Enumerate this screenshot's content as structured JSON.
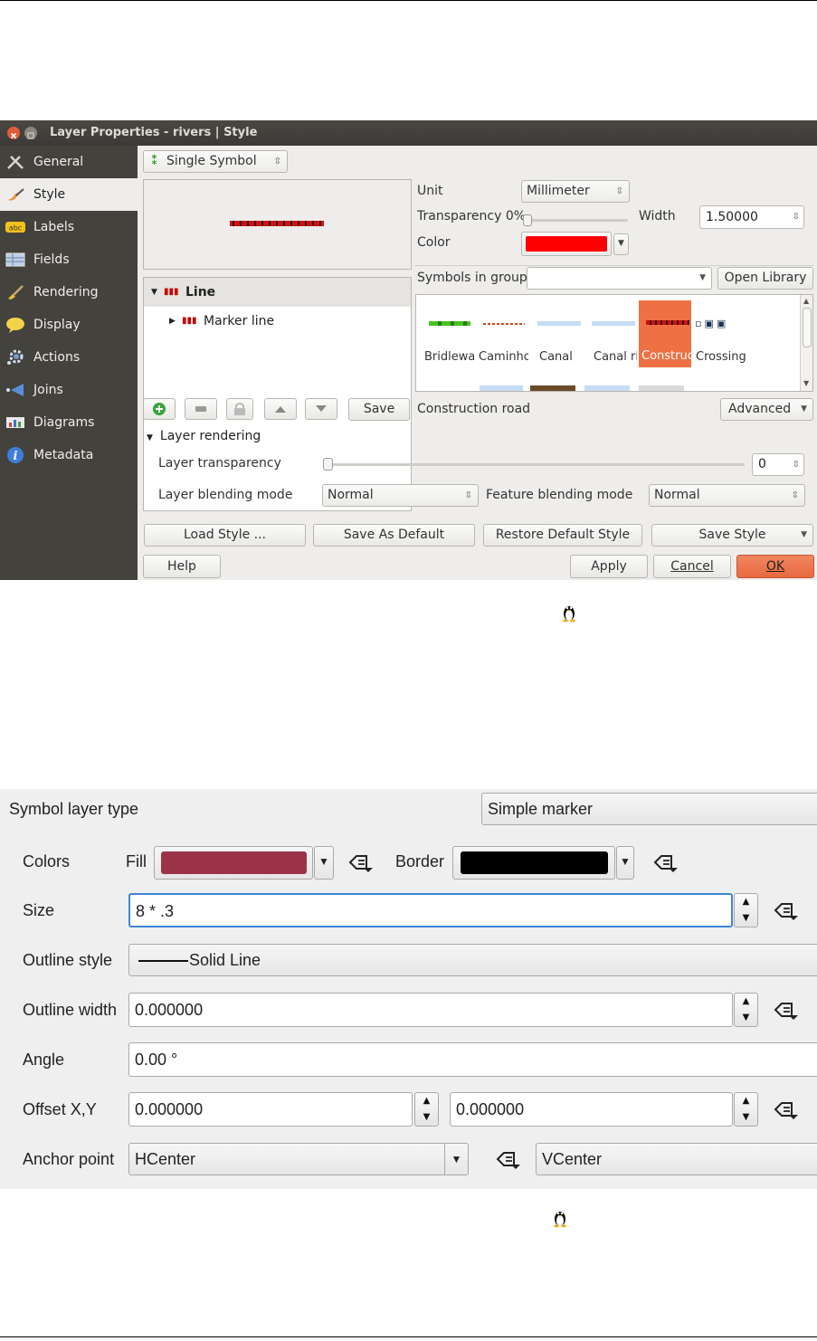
{
  "dialog1": {
    "title": "Layer Properties - rivers | Style",
    "sidebar": {
      "items": [
        {
          "label": "General",
          "icon": "wrench-icon"
        },
        {
          "label": "Style",
          "icon": "brush-icon"
        },
        {
          "label": "Labels",
          "icon": "abc-label-icon"
        },
        {
          "label": "Fields",
          "icon": "table-icon"
        },
        {
          "label": "Rendering",
          "icon": "paintbrush-icon"
        },
        {
          "label": "Display",
          "icon": "speech-bubble-icon"
        },
        {
          "label": "Actions",
          "icon": "gear-icon"
        },
        {
          "label": "Joins",
          "icon": "join-arrow-icon"
        },
        {
          "label": "Diagrams",
          "icon": "diagram-icon"
        },
        {
          "label": "Metadata",
          "icon": "info-icon"
        }
      ],
      "active": "Style"
    },
    "renderer_type": "Single Symbol",
    "unit_label": "Unit",
    "unit_value": "Millimeter",
    "transparency_label": "Transparency 0%",
    "width_label": "Width",
    "width_value": "1.50000",
    "color_label": "Color",
    "color_value": "#ff0000",
    "symbol_tree": {
      "root": "Line",
      "child": "Marker line"
    },
    "symbols_in_group_label": "Symbols in group",
    "symbols_in_group_value": "",
    "open_library_label": "Open Library",
    "symbols": [
      {
        "label": "Bridlewa"
      },
      {
        "label": "Caminho"
      },
      {
        "label": "Canal"
      },
      {
        "label": "Canal ri"
      },
      {
        "label": "Construc",
        "selected": true
      },
      {
        "label": "Crossing"
      }
    ],
    "save_label": "Save",
    "selected_symbol_name": "Construction road",
    "advanced_label": "Advanced",
    "layer_rendering_label": "Layer rendering",
    "layer_transparency_label": "Layer transparency",
    "layer_transparency_value": "0",
    "layer_blending_label": "Layer blending mode",
    "layer_blending_value": "Normal",
    "feature_blending_label": "Feature blending mode",
    "feature_blending_value": "Normal",
    "load_style_label": "Load Style ...",
    "save_default_label": "Save As Default",
    "restore_default_label": "Restore Default Style",
    "save_style_label": "Save Style",
    "help_label": "Help",
    "apply_label": "Apply",
    "cancel_label": "Cancel",
    "ok_label": "OK"
  },
  "dialog2": {
    "symbol_layer_type_label": "Symbol layer type",
    "symbol_layer_type_value": "Simple marker",
    "colors_label": "Colors",
    "fill_label": "Fill",
    "fill_color": "#9b3348",
    "border_label": "Border",
    "border_color": "#000000",
    "size_label": "Size",
    "size_value": "8 * .3",
    "outline_style_label": "Outline style",
    "outline_style_value": "Solid Line",
    "outline_width_label": "Outline width",
    "outline_width_value": "0.000000",
    "angle_label": "Angle",
    "angle_value": "0.00 °",
    "offset_label": "Offset X,Y",
    "offset_x_value": "0.000000",
    "offset_y_value": "0.000000",
    "anchor_label": "Anchor point",
    "anchor_h_value": "HCenter",
    "anchor_v_value": "VCenter"
  }
}
